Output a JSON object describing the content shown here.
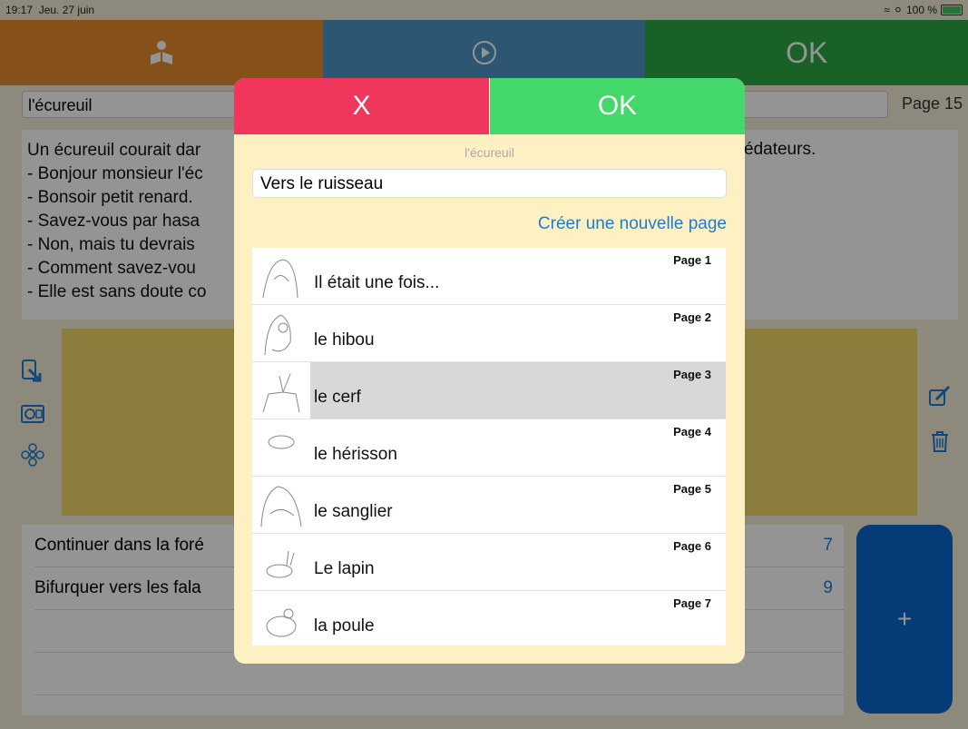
{
  "status": {
    "time": "19:17",
    "date": "Jeu. 27 juin",
    "battery": "100 %"
  },
  "topbar": {
    "ok_label": "OK"
  },
  "editor": {
    "title": "l'écureuil",
    "page_label": "Page 15",
    "story_lines": [
      "Un écureuil courait dar",
      "- Bonjour monsieur l'éc",
      "- Bonsoir petit renard.",
      "- Savez-vous par hasa",
      "- Non, mais tu devrais",
      "- Comment savez-vou",
      "- Elle est sans doute co"
    ],
    "story_tail": "édateurs.",
    "choices": [
      {
        "label": "Continuer dans la foré",
        "target": "7"
      },
      {
        "label": "Bifurquer vers les fala",
        "target": "9"
      }
    ],
    "add_label": "+"
  },
  "modal": {
    "cancel_label": "X",
    "ok_label": "OK",
    "subtitle": "l'écureuil",
    "input_value": "Vers le ruisseau",
    "new_page_label": "Créer une nouvelle page",
    "pages": [
      {
        "number": "Page 1",
        "title": "Il était une fois..."
      },
      {
        "number": "Page 2",
        "title": "le hibou"
      },
      {
        "number": "Page 3",
        "title": "le cerf",
        "selected": true
      },
      {
        "number": "Page 4",
        "title": "le hérisson"
      },
      {
        "number": "Page 5",
        "title": "le sanglier"
      },
      {
        "number": "Page 6",
        "title": "Le lapin"
      },
      {
        "number": "Page 7",
        "title": "la poule"
      }
    ]
  }
}
